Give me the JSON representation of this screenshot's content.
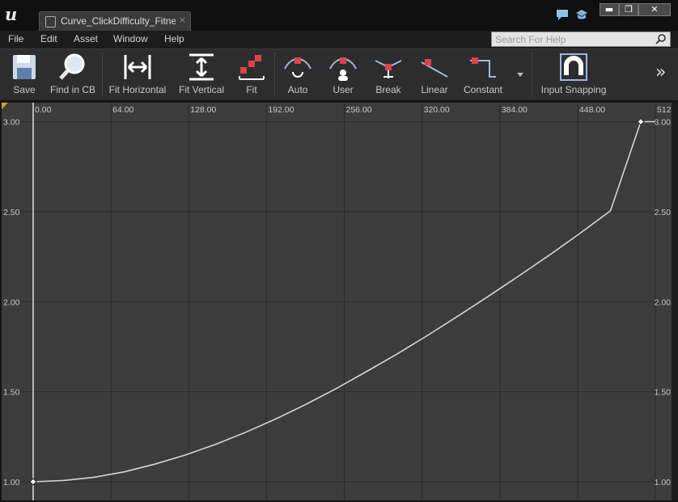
{
  "window": {
    "tab_title": "Curve_ClickDifficulty_Fitne",
    "tab_close": "×",
    "minimize": "▬",
    "maximize": "❐",
    "close": "✕"
  },
  "menu": [
    "File",
    "Edit",
    "Asset",
    "Window",
    "Help"
  ],
  "search": {
    "placeholder": "Search For Help",
    "value": ""
  },
  "toolbar": {
    "save": "Save",
    "find_in_cb": "Find in CB",
    "fit_horizontal": "Fit Horizontal",
    "fit_vertical": "Fit Vertical",
    "fit": "Fit",
    "auto": "Auto",
    "user": "User",
    "break": "Break",
    "linear": "Linear",
    "constant": "Constant",
    "input_snapping": "Input Snapping",
    "overflow": "»"
  },
  "colors": {
    "graph_bg": "#3c3c3c",
    "grid": "#2a2a2a",
    "curve": "#d6d6d6",
    "key_fill": "#ffffff",
    "key_marker_red": "#c0392b"
  },
  "chart_data": {
    "type": "line",
    "title": "",
    "xlabel": "",
    "ylabel": "",
    "xlim": [
      0,
      512
    ],
    "ylim": [
      1.0,
      3.0
    ],
    "x_ticks": [
      "0.00",
      "64.00",
      "128.00",
      "192.00",
      "256.00",
      "320.00",
      "384.00",
      "448.00",
      "512"
    ],
    "x_tick_values": [
      0,
      64,
      128,
      192,
      256,
      320,
      384,
      448,
      512
    ],
    "y_ticks": [
      "3.00",
      "2.50",
      "2.00",
      "1.50",
      "1.00"
    ],
    "y_tick_values": [
      3.0,
      2.5,
      2.0,
      1.5,
      1.0
    ],
    "keys": [
      {
        "x": 0,
        "y": 1.0
      },
      {
        "x": 500,
        "y": 3.0
      }
    ],
    "series": [
      {
        "x": [
          0,
          25,
          50,
          75,
          100,
          125,
          150,
          175,
          200,
          225,
          250,
          275,
          300,
          325,
          350,
          375,
          400,
          425,
          450,
          475,
          500,
          512
        ],
        "values": [
          1.0,
          1.007,
          1.025,
          1.055,
          1.098,
          1.148,
          1.208,
          1.275,
          1.35,
          1.432,
          1.52,
          1.615,
          1.712,
          1.815,
          1.922,
          2.032,
          2.145,
          2.26,
          2.38,
          2.505,
          3.0,
          3.0
        ]
      }
    ],
    "grid": true,
    "legend": "none"
  }
}
